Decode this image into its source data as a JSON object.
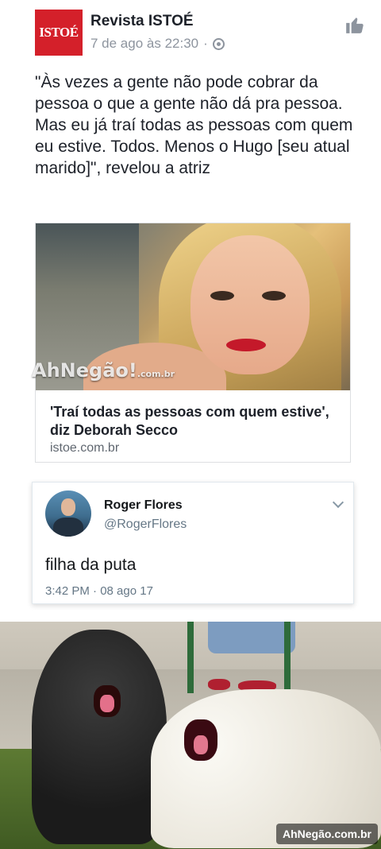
{
  "post": {
    "logo_text": "ISTOÉ",
    "page_name": "Revista ISTOÉ",
    "timestamp": "7 de ago às 22:30",
    "separator": "·",
    "text": "\"Às vezes a gente não pode cobrar da pessoa o que a gente não dá pra pessoa. Mas eu já traí todas as pessoas com quem eu estive. Todos. Menos o Hugo [seu atual marido]\", revelou a atriz",
    "link": {
      "title": "'Traí todas as pessoas com quem estive', diz Deborah Secco",
      "domain": "istoe.com.br"
    },
    "watermark": "AhNegão!",
    "watermark_suffix": ".com.br"
  },
  "tweet": {
    "name": "Roger Flores",
    "handle": "@RogerFlores",
    "text": "filha da puta",
    "time": "3:42 PM · 08 ago 17"
  },
  "photo": {
    "watermark": "AhNegão.com.br"
  },
  "colors": {
    "istoe_red": "#d4202a",
    "meta_gray": "#8d949e",
    "twitter_gray": "#657786"
  }
}
